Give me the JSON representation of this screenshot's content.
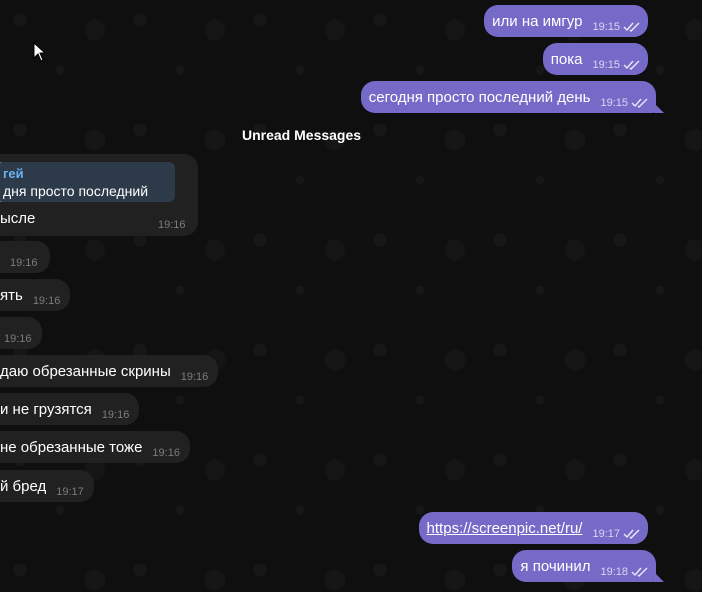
{
  "outgoing_top": [
    {
      "text": "или на имгур",
      "time": "19:15"
    },
    {
      "text": "пока",
      "time": "19:15"
    },
    {
      "text": "сегодня просто последний день",
      "time": "19:15"
    }
  ],
  "unread_label": "Unread Messages",
  "reply_message": {
    "quoted_name": "гей",
    "quoted_text": "дня просто последний день",
    "text": "ысле",
    "time": "19:16"
  },
  "incoming": [
    {
      "text": "",
      "time": "19:16"
    },
    {
      "text": "ять",
      "time": "19:16"
    },
    {
      "text": "",
      "time": "19:16"
    },
    {
      "text": "даю обрезанные скрины",
      "time": "19:16"
    },
    {
      "text": "и не грузятся",
      "time": "19:16"
    },
    {
      "text": "не обрезанные тоже",
      "time": "19:16"
    },
    {
      "text": "й бред",
      "time": "19:17"
    }
  ],
  "outgoing_bottom": [
    {
      "text": "https://screenpic.net/ru/",
      "time": "19:17",
      "is_link": true
    },
    {
      "text": "я починил",
      "time": "19:18"
    }
  ],
  "colors": {
    "outgoing_bubble": "#766ac8",
    "incoming_bubble": "#212121",
    "reply_accent": "#6ab2f2"
  }
}
